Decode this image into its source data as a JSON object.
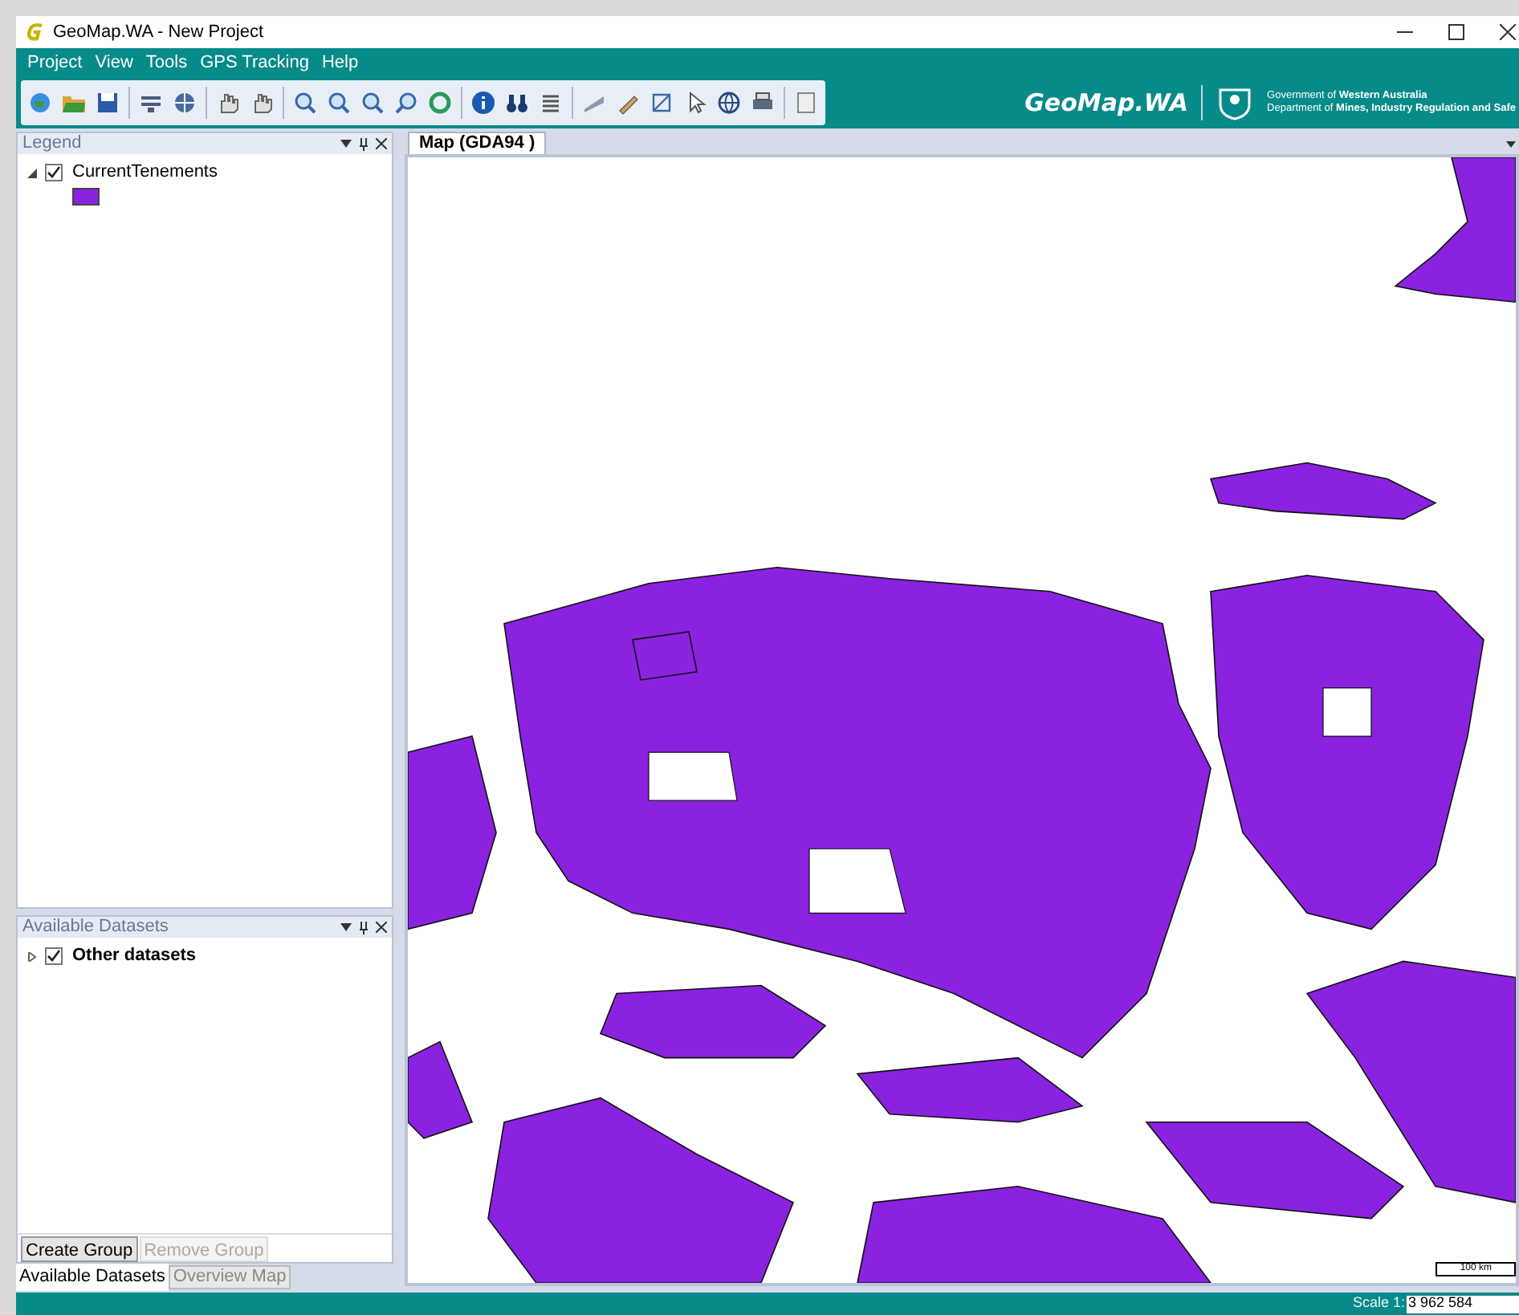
{
  "window": {
    "title": "GeoMap.WA - New Project"
  },
  "menu": [
    "Project",
    "View",
    "Tools",
    "GPS Tracking",
    "Help"
  ],
  "branding": {
    "logo": "GeoMap.WA",
    "agency_line1": "Government of **Western Australia**",
    "agency_line2": "Department of **Mines, Industry Regulation and Safe**"
  },
  "legend_panel": {
    "title": "Legend",
    "layers": [
      {
        "name": "CurrentTenements",
        "checked": true,
        "expanded": true,
        "color": "#8a22e0"
      }
    ]
  },
  "datasets_panel": {
    "title": "Available Datasets",
    "items": [
      {
        "name": "Other datasets",
        "checked": true,
        "expanded": false
      }
    ],
    "buttons": [
      {
        "label": "Create Group",
        "disabled": false
      },
      {
        "label": "Remove Group",
        "disabled": true
      }
    ]
  },
  "left_tabs": [
    {
      "label": "Available Datasets",
      "selected": true
    },
    {
      "label": "Overview Map",
      "selected": false
    }
  ],
  "map": {
    "tab": "Map (GDA94 )",
    "scale_bar": "100 km"
  },
  "status_bar": {
    "scale_label": "Scale 1:",
    "scale_value": "3 962 584"
  }
}
